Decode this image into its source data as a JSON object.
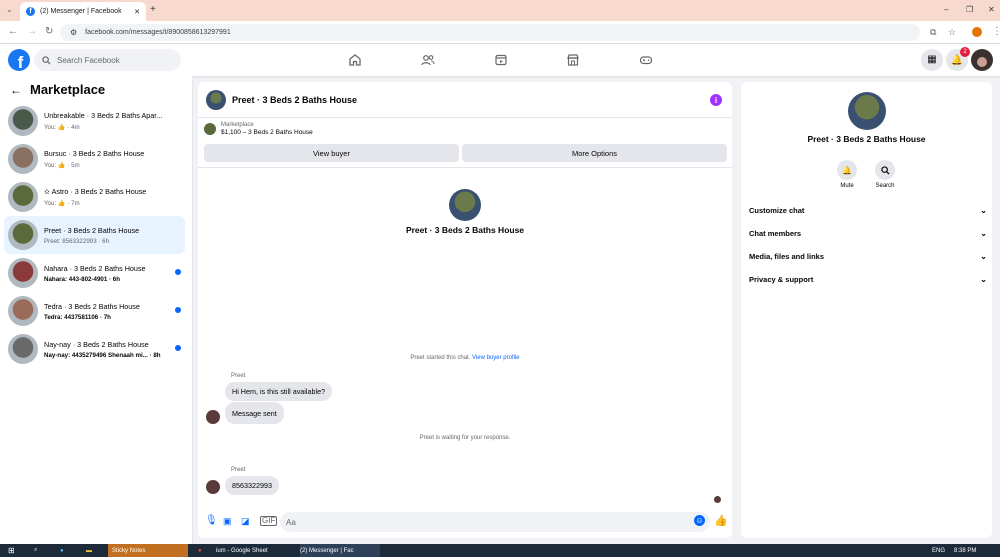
{
  "browser": {
    "tab_title": "(2) Messenger | Facebook",
    "tab_favicon": "f",
    "new_tab": "+",
    "url": "facebook.com/messages/t/8900858613297991",
    "window_controls": [
      "–",
      "❐",
      "✕"
    ]
  },
  "header": {
    "search_placeholder": "Search Facebook",
    "notifications_count": "2"
  },
  "left": {
    "title": "Marketplace",
    "conversations": [
      {
        "title": "Unbreakable · 3 Beds 2 Baths Apar...",
        "sub": "You: 👍 · 4m",
        "unread": false,
        "selected": false,
        "color": "#4a5a4a"
      },
      {
        "title": "Bursuc · 3 Beds 2 Baths House",
        "sub": "You: 👍 · 5m",
        "unread": false,
        "selected": false,
        "color": "#8a7060"
      },
      {
        "title": "✫ Astro · 3 Beds 2 Baths House",
        "sub": "You: 👍 · 7m",
        "unread": false,
        "selected": false,
        "color": "#5a6a3a"
      },
      {
        "title": "Preet · 3 Beds 2 Baths House",
        "sub": "Preet: 8563322993 · 6h",
        "unread": false,
        "selected": true,
        "color": "#5a6a3a"
      },
      {
        "title": "Nahara · 3 Beds 2 Baths House",
        "sub": "Nahara: 443-802-4901 · 6h",
        "unread": true,
        "selected": false,
        "color": "#8a3a3a"
      },
      {
        "title": "Tedra · 3 Beds 2 Baths House",
        "sub": "Tedra: 4437581106 · 7h",
        "unread": true,
        "selected": false,
        "color": "#9a6a5a"
      },
      {
        "title": "Nay-nay · 3 Beds 2 Baths House",
        "sub": "Nay-nay: 4435279496 Shenaah mi... · 8h",
        "unread": true,
        "selected": false,
        "color": "#6a6a6a"
      }
    ]
  },
  "chat": {
    "title": "Preet · 3 Beds 2 Baths House",
    "marketplace_label": "Marketplace",
    "listing": "$1,100 – 3 Beds 2 Baths House",
    "view_buyer": "View buyer",
    "more_options": "More Options",
    "center_name": "Preet · 3 Beds 2 Baths House",
    "started_text": "Preet started this chat.",
    "view_profile": "View buyer profile",
    "sender1": "Preet",
    "msg1": "Hi Hem, is this still available?",
    "msg2": "Message sent",
    "waiting": "Preet is waiting for your response.",
    "sender2": "Preet",
    "msg3": "8563322993",
    "input_placeholder": "Aa"
  },
  "right": {
    "name": "Preet · 3 Beds 2 Baths House",
    "mute": "Mute",
    "search": "Search",
    "rows": [
      "Customize chat",
      "Chat members",
      "Media, files and links",
      "Privacy & support"
    ]
  },
  "taskbar": {
    "sticky": "Sticky Notes",
    "chrome1": "ium - Google Sheet",
    "chrome2": "(2) Messenger | Fac",
    "time": "8:38 PM",
    "lang": "ENG"
  },
  "colors": {
    "accent": "#1877f2",
    "unread": "#0866ff",
    "info": "#a033ff"
  }
}
